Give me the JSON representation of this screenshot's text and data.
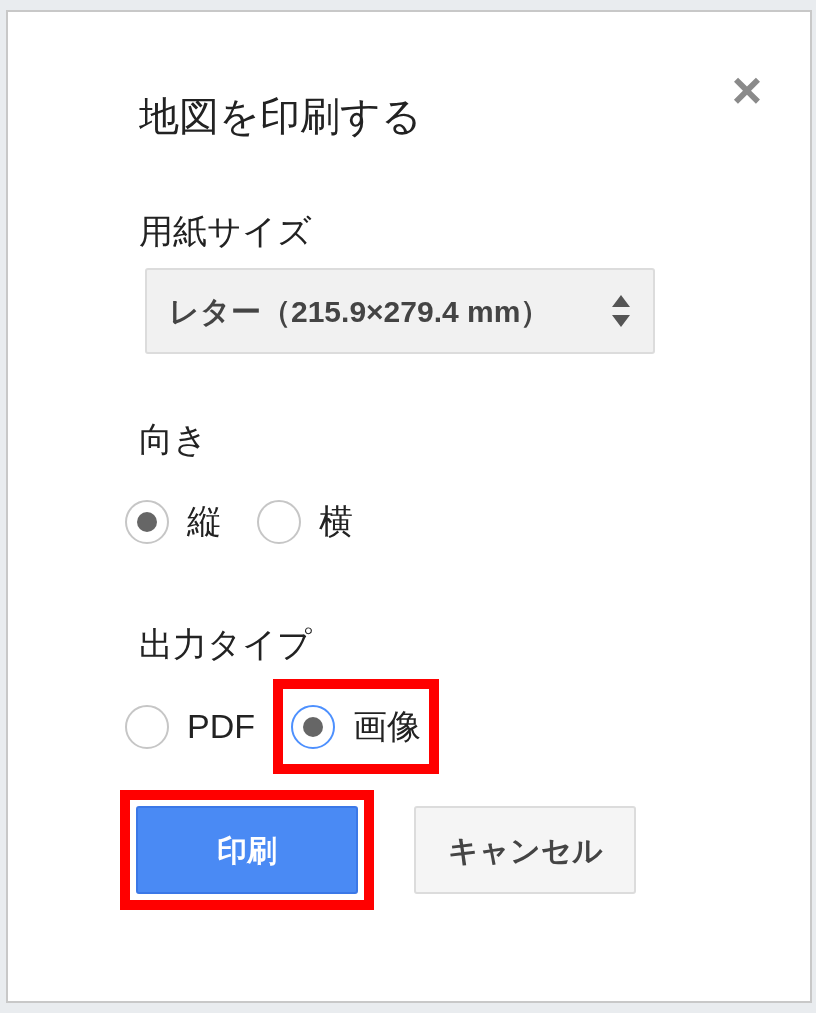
{
  "dialog": {
    "title": "地図を印刷する",
    "close": "×",
    "paper_size": {
      "label": "用紙サイズ",
      "value": "レター（215.9×279.4 mm）"
    },
    "orientation": {
      "label": "向き",
      "options": [
        {
          "label": "縦",
          "selected": true,
          "focused": false,
          "highlighted": false
        },
        {
          "label": "横",
          "selected": false,
          "focused": false,
          "highlighted": false
        }
      ]
    },
    "output_type": {
      "label": "出力タイプ",
      "options": [
        {
          "label": "PDF",
          "selected": false,
          "focused": false,
          "highlighted": false
        },
        {
          "label": "画像",
          "selected": true,
          "focused": true,
          "highlighted": true
        }
      ]
    },
    "buttons": [
      {
        "kind": "primary",
        "label": "印刷",
        "highlighted": true
      },
      {
        "kind": "secondary",
        "label": "キャンセル",
        "highlighted": false
      }
    ]
  }
}
